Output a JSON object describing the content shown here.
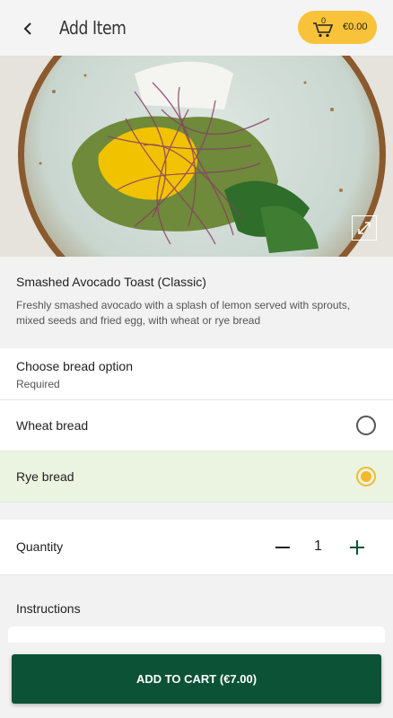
{
  "header": {
    "title": "Add Item",
    "back_icon": "chevron-left-icon",
    "cart": {
      "count": "0",
      "total": "€0.00",
      "icon": "cart-icon",
      "color": "#f8c33a"
    }
  },
  "hero": {
    "image_desc": "food-photo",
    "expand_icon": "expand-icon"
  },
  "item": {
    "name": "Smashed Avocado Toast (Classic)",
    "description": "Freshly smashed avocado with a splash of lemon served with sprouts, mixed seeds and fried egg, with wheat or rye bread"
  },
  "options": {
    "title": "Choose bread option",
    "subtitle": "Required",
    "items": [
      {
        "label": "Wheat bread",
        "selected": false
      },
      {
        "label": "Rye bread",
        "selected": true
      }
    ]
  },
  "quantity": {
    "label": "Quantity",
    "value": "1"
  },
  "instructions": {
    "title": "Instructions"
  },
  "footer": {
    "add_label": "ADD TO CART  (€7.00)",
    "button_color": "#0c5237"
  },
  "colors": {
    "accent": "#f8c33a",
    "brand": "#0c5237",
    "selected_bg": "#eaf4e1"
  }
}
